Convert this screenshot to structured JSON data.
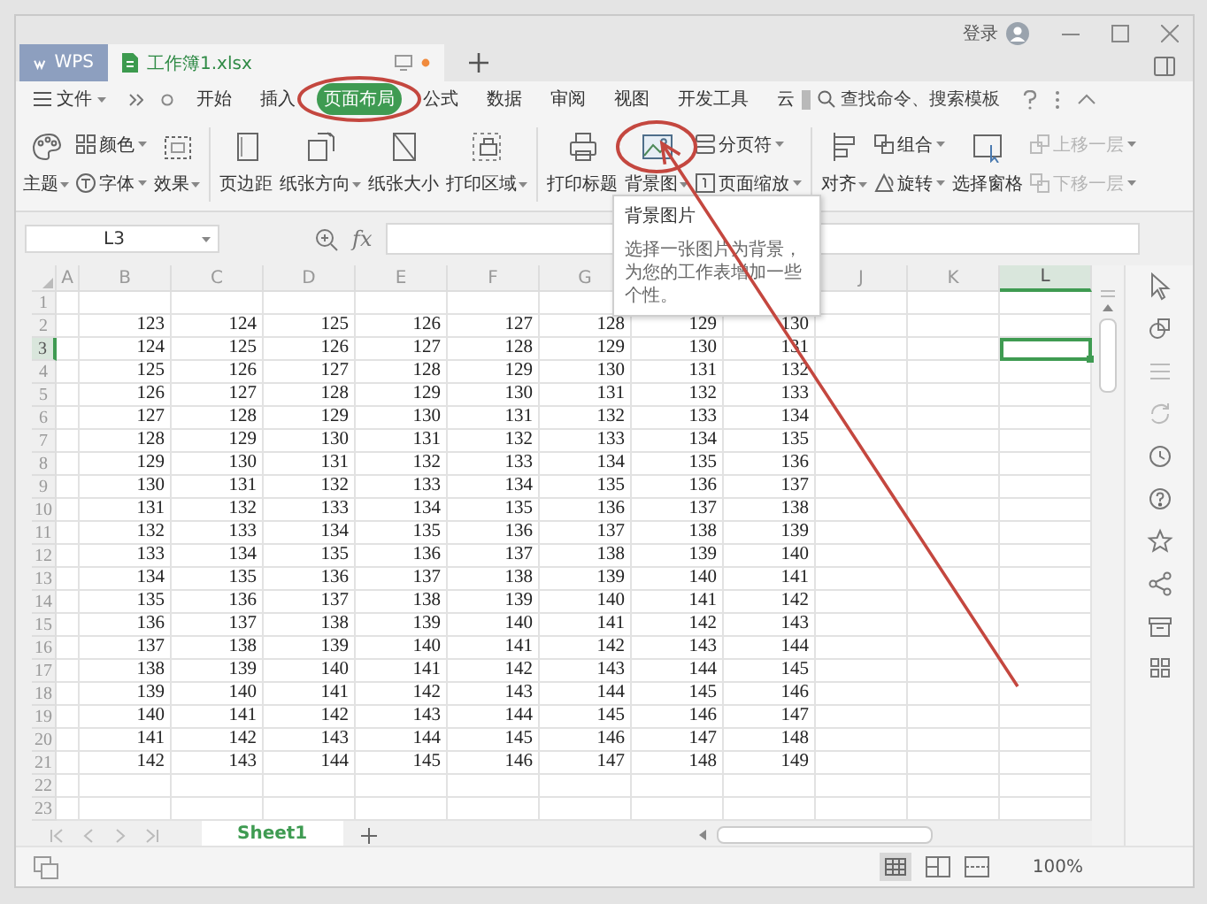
{
  "tabs": [
    {
      "label": "WPS",
      "kind": "home",
      "selected": false,
      "unsaved": false
    },
    {
      "label": "工作簿1.xlsx",
      "kind": "doc",
      "selected": true,
      "unsaved": true
    }
  ],
  "account": {
    "login": "登录"
  },
  "menu": {
    "file": "文件",
    "items": [
      {
        "label": "开始",
        "selected": false
      },
      {
        "label": "插入",
        "selected": false
      },
      {
        "label": "页面布局",
        "selected": true
      },
      {
        "label": "公式",
        "selected": false
      },
      {
        "label": "数据",
        "selected": false
      },
      {
        "label": "审阅",
        "selected": false
      },
      {
        "label": "视图",
        "selected": false
      },
      {
        "label": "开发工具",
        "selected": false
      },
      {
        "label": "云",
        "selected": false
      }
    ],
    "search": {
      "placeholder": "查找命令、搜索模板"
    }
  },
  "ribbon": [
    {
      "kind": "large",
      "label": "主题",
      "dropdown": true,
      "disabled": false
    },
    {
      "kind": "stack",
      "items": [
        {
          "label": "颜色",
          "dropdown": true,
          "disabled": false
        },
        {
          "label": "字体",
          "dropdown": true,
          "disabled": false
        }
      ]
    },
    {
      "kind": "large",
      "label": "效果",
      "dropdown": true,
      "disabled": false
    },
    {
      "kind": "separator"
    },
    {
      "kind": "large",
      "label": "页边距",
      "dropdown": false,
      "disabled": false
    },
    {
      "kind": "large",
      "label": "纸张方向",
      "dropdown": true,
      "disabled": false
    },
    {
      "kind": "large",
      "label": "纸张大小",
      "dropdown": false,
      "disabled": false
    },
    {
      "kind": "large",
      "label": "打印区域",
      "dropdown": true,
      "disabled": false
    },
    {
      "kind": "separator"
    },
    {
      "kind": "large",
      "label": "打印标题",
      "dropdown": false,
      "disabled": false
    },
    {
      "kind": "large",
      "label": "背景图",
      "dropdown": true,
      "disabled": false
    },
    {
      "kind": "stack",
      "items": [
        {
          "label": "分页符",
          "dropdown": true,
          "disabled": false
        },
        {
          "label": "页面缩放",
          "dropdown": true,
          "disabled": false
        }
      ]
    },
    {
      "kind": "separator"
    },
    {
      "kind": "large",
      "label": "对齐",
      "dropdown": true,
      "disabled": false
    },
    {
      "kind": "stack",
      "items": [
        {
          "label": "组合",
          "dropdown": true,
          "disabled": false
        },
        {
          "label": "旋转",
          "dropdown": true,
          "disabled": false
        }
      ]
    },
    {
      "kind": "large",
      "label": "选择窗格",
      "dropdown": false,
      "disabled": false
    },
    {
      "kind": "stack",
      "items": [
        {
          "label": "上移一层",
          "dropdown": true,
          "disabled": true
        },
        {
          "label": "下移一层",
          "dropdown": true,
          "disabled": true
        }
      ]
    }
  ],
  "tooltip": {
    "title": "背景图片",
    "text": "选择一张图片为背景，为您的工作表增加一些个性。"
  },
  "formula_bar": {
    "name_box": "L3",
    "function_label": "fx"
  },
  "sheet": {
    "columns": [
      {
        "label": "A",
        "selected": false
      },
      {
        "label": "B",
        "selected": false
      },
      {
        "label": "C",
        "selected": false
      },
      {
        "label": "D",
        "selected": false
      },
      {
        "label": "E",
        "selected": false
      },
      {
        "label": "F",
        "selected": false
      },
      {
        "label": "G",
        "selected": false
      },
      {},
      {},
      {
        "label": "J",
        "selected": false
      },
      {
        "label": "K",
        "selected": false
      },
      {
        "label": "L",
        "selected": true
      }
    ],
    "rows": [
      {
        "header": "1",
        "selected": false
      },
      {
        "header": "2",
        "selected": false,
        "cells": [
          "123",
          "124",
          "125",
          "126",
          "127",
          "128",
          "129",
          "130"
        ]
      },
      {
        "header": "3",
        "selected": true,
        "cells": [
          "124",
          "125",
          "126",
          "127",
          "128",
          "129",
          "130",
          "131"
        ]
      },
      {
        "header": "4",
        "selected": false,
        "cells": [
          "125",
          "126",
          "127",
          "128",
          "129",
          "130",
          "131",
          "132"
        ]
      },
      {
        "header": "5",
        "selected": false,
        "cells": [
          "126",
          "127",
          "128",
          "129",
          "130",
          "131",
          "132",
          "133"
        ]
      },
      {
        "header": "6",
        "selected": false,
        "cells": [
          "127",
          "128",
          "129",
          "130",
          "131",
          "132",
          "133",
          "134"
        ]
      },
      {
        "header": "7",
        "selected": false,
        "cells": [
          "128",
          "129",
          "130",
          "131",
          "132",
          "133",
          "134",
          "135"
        ]
      },
      {
        "header": "8",
        "selected": false,
        "cells": [
          "129",
          "130",
          "131",
          "132",
          "133",
          "134",
          "135",
          "136"
        ]
      },
      {
        "header": "9",
        "selected": false,
        "cells": [
          "130",
          "131",
          "132",
          "133",
          "134",
          "135",
          "136",
          "137"
        ]
      },
      {
        "header": "10",
        "selected": false,
        "cells": [
          "131",
          "132",
          "133",
          "134",
          "135",
          "136",
          "137",
          "138"
        ]
      },
      {
        "header": "11",
        "selected": false,
        "cells": [
          "132",
          "133",
          "134",
          "135",
          "136",
          "137",
          "138",
          "139"
        ]
      },
      {
        "header": "12",
        "selected": false,
        "cells": [
          "133",
          "134",
          "135",
          "136",
          "137",
          "138",
          "139",
          "140"
        ]
      },
      {
        "header": "13",
        "selected": false,
        "cells": [
          "134",
          "135",
          "136",
          "137",
          "138",
          "139",
          "140",
          "141"
        ]
      },
      {
        "header": "14",
        "selected": false,
        "cells": [
          "135",
          "136",
          "137",
          "138",
          "139",
          "140",
          "141",
          "142"
        ]
      },
      {
        "header": "15",
        "selected": false,
        "cells": [
          "136",
          "137",
          "138",
          "139",
          "140",
          "141",
          "142",
          "143"
        ]
      },
      {
        "header": "16",
        "selected": false,
        "cells": [
          "137",
          "138",
          "139",
          "140",
          "141",
          "142",
          "143",
          "144"
        ]
      },
      {
        "header": "17",
        "selected": false,
        "cells": [
          "138",
          "139",
          "140",
          "141",
          "142",
          "143",
          "144",
          "145"
        ]
      },
      {
        "header": "18",
        "selected": false,
        "cells": [
          "139",
          "140",
          "141",
          "142",
          "143",
          "144",
          "145",
          "146"
        ]
      },
      {
        "header": "19",
        "selected": false,
        "cells": [
          "140",
          "141",
          "142",
          "143",
          "144",
          "145",
          "146",
          "147"
        ]
      },
      {
        "header": "20",
        "selected": false,
        "cells": [
          "141",
          "142",
          "143",
          "144",
          "145",
          "146",
          "147",
          "148"
        ]
      },
      {
        "header": "21",
        "selected": false,
        "cells": [
          "142",
          "143",
          "144",
          "145",
          "146",
          "147",
          "148",
          "149"
        ]
      },
      {
        "header": "22",
        "selected": false
      },
      {
        "header": "23",
        "selected": false
      }
    ]
  },
  "sheet_tabs": [
    {
      "label": "Sheet1",
      "selected": true
    }
  ],
  "status_bar": {
    "zoom": "100%"
  }
}
